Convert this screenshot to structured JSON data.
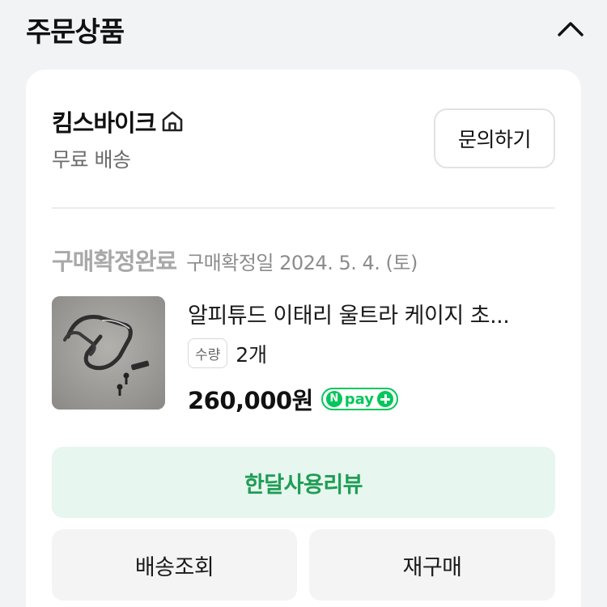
{
  "section": {
    "title": "주문상품",
    "toggle_icon": "chevron-up-icon"
  },
  "store": {
    "name": "킴스바이크",
    "home_icon": "home-icon",
    "shipping": "무료 배송",
    "inquiry_label": "문의하기"
  },
  "order": {
    "status": "구매확정완료",
    "confirm_date": "구매확정일 2024. 5. 4. (토)"
  },
  "product": {
    "name": "알피튜드 이태리 울트라 케이지 초...",
    "qty_label": "수량",
    "qty_value": "2개",
    "price": "260,000원",
    "pay_badge": "pay"
  },
  "actions": {
    "review_label": "한달사용리뷰",
    "track_label": "배송조회",
    "rebuy_label": "재구매"
  },
  "colors": {
    "accent_green": "#03c75a",
    "review_bg": "#e7f6ee",
    "review_text": "#1f9d55",
    "status_gray": "#a8a8a8"
  }
}
